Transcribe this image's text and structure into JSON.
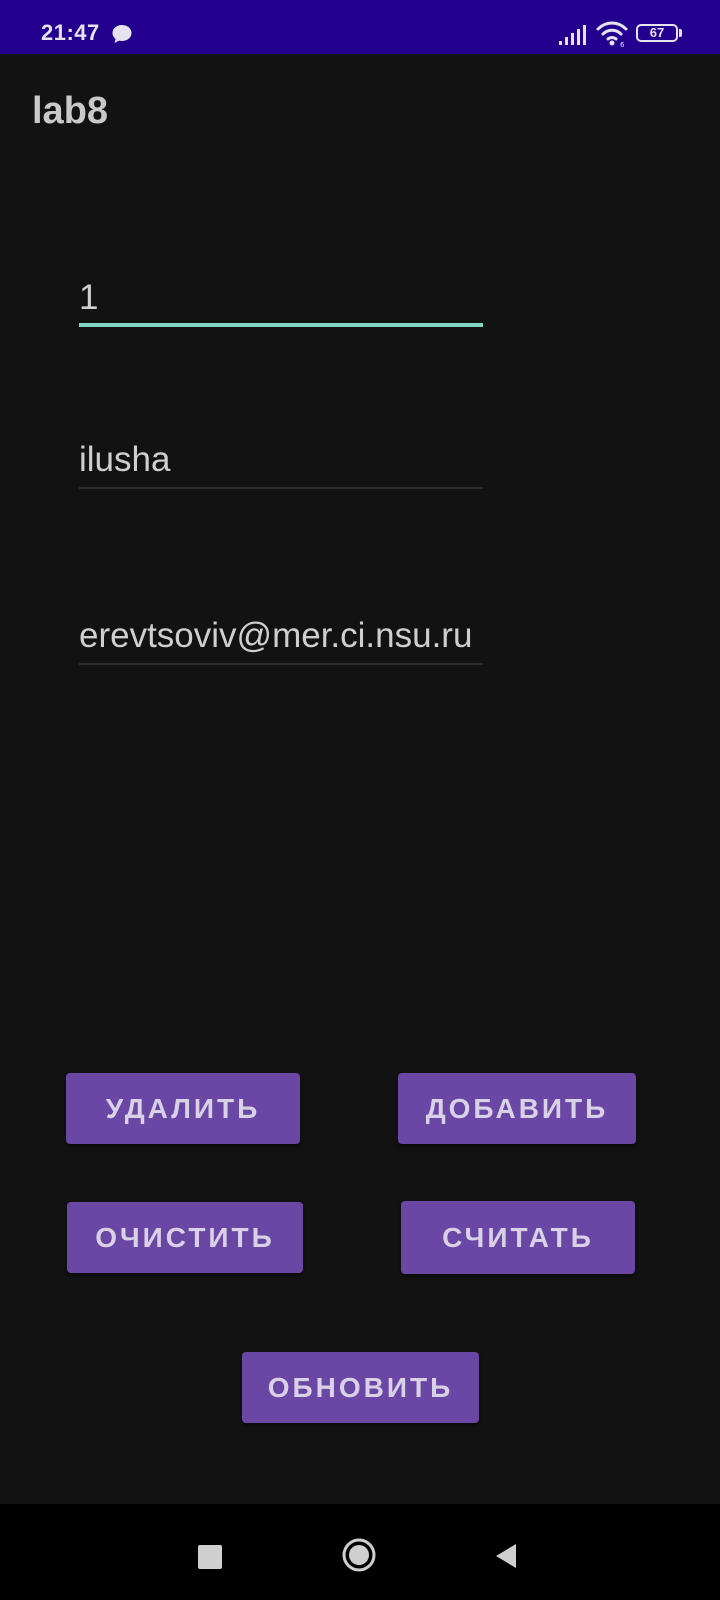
{
  "status_bar": {
    "time": "21:47",
    "battery_level": "67",
    "icons": [
      "message-icon",
      "signal-icon",
      "wifi-icon",
      "battery-icon"
    ],
    "background_color": "#24008f"
  },
  "app_bar": {
    "title": "lab8"
  },
  "form": {
    "id_field": {
      "value": "1"
    },
    "name_field": {
      "value": "ilusha"
    },
    "email_field": {
      "value": "erevtsoviv@mer.ci.nsu.ru"
    },
    "focus_color": "#7fd8c4"
  },
  "buttons": {
    "delete": "УДАЛИТЬ",
    "add": "ДОБАВИТЬ",
    "clear": "ОЧИСТИТЬ",
    "read": "СЧИТАТЬ",
    "refresh": "ОБНОВИТЬ",
    "color": "#6a46a5"
  },
  "nav_bar": {
    "icons": [
      "recents-icon",
      "home-icon",
      "back-icon"
    ]
  }
}
